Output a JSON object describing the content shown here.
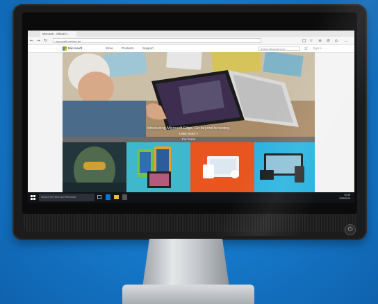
{
  "browser": {
    "tab_title": "Microsoft - Official H...",
    "url": "microsoft.com/en-us",
    "nav": {
      "back": "←",
      "forward": "→",
      "refresh": "↻"
    },
    "tools": [
      "□",
      "☆",
      "≡",
      "⊘",
      "⌂",
      "…"
    ]
  },
  "site": {
    "brand": "Microsoft",
    "menu": [
      "Store",
      "Products",
      "Support"
    ],
    "search_placeholder": "Search Microsoft.com",
    "cart": "🛒",
    "signin": "Sign in"
  },
  "hero": {
    "caption": "Introducing Microsoft Edge. Go beyond browsing.",
    "cta": "Learn more >"
  },
  "strip": {
    "label": "For home"
  },
  "taskbar": {
    "search_placeholder": "Search the web and Windows",
    "time": "10:35",
    "date": "7/29/2015"
  },
  "colors": {
    "background": "#1577c8",
    "edge_blue": "#0078d7",
    "tile_orange": "#e8551e",
    "tile_cyan": "#2bb4e0"
  },
  "icons": {
    "power": "power-icon",
    "start": "windows-start-icon",
    "back": "back-arrow-icon",
    "refresh": "refresh-icon"
  }
}
